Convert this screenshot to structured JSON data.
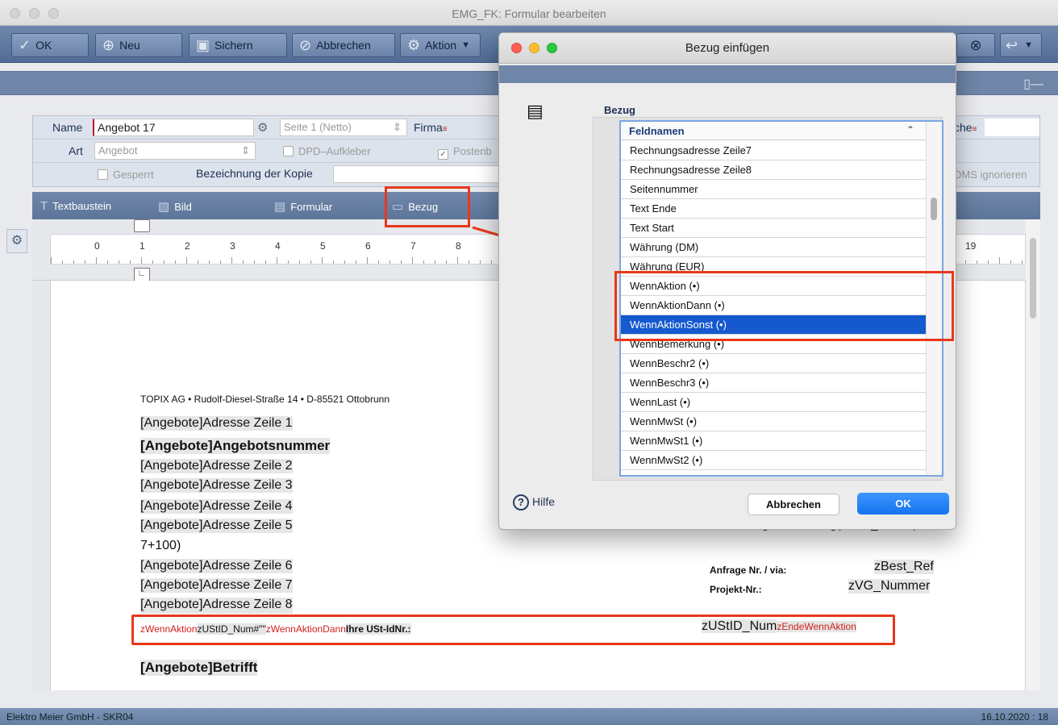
{
  "window": {
    "title": "EMG_FK: Formular bearbeiten"
  },
  "toolbar": {
    "ok": "OK",
    "neu": "Neu",
    "sichern": "Sichern",
    "abbrechen": "Abbrechen",
    "aktion": "Aktion"
  },
  "form": {
    "name_label": "Name",
    "name_value": "Angebot 17",
    "seite_value": "Seite 1 (Netto)",
    "firma_label": "Firma",
    "suche_label": "che",
    "art_label": "Art",
    "art_value": "Angebot",
    "dpd_label": "DPD–Aufkleber",
    "posten_label": "Postenb",
    "gesperrt_label": "Gesperrt",
    "kopie_label": "Bezeichnung der Kopie",
    "dms_label": "DMS ignorieren"
  },
  "editor_toolbar": {
    "textbaustein": "Textbaustein",
    "bild": "Bild",
    "formular": "Formular",
    "bezug": "Bezug"
  },
  "ruler": {
    "numbers": [
      "0",
      "1",
      "2",
      "3",
      "4",
      "5",
      "6",
      "7",
      "8",
      "19"
    ]
  },
  "document": {
    "sender": "TOPIX AG • Rudolf-Diesel-Straße 14 • D-85521 Ottobrunn",
    "line1": "[Angebote]Adresse Zeile 1",
    "line_nr": "[Angebote]Angebotsnummer",
    "line2": "[Angebote]Adresse Zeile 2",
    "line3": "[Angebote]Adresse Zeile 3",
    "line4": "[Angebote]Adresse Zeile 4",
    "line5": "[Angebote]Adresse Zeile 5",
    "line5b": "7+100)",
    "line6": "[Angebote]Adresse Zeile 6",
    "line7": "[Angebote]Adresse Zeile 7",
    "line8": "[Angebote]Adresse Zeile 8",
    "betrifft": "[Angebote]Betrifft",
    "anfrage_partial": "Ihre Anfrage vom:String(zBest_Datum)",
    "anfrage_nr_label": "Anfrage Nr. / via:",
    "anfrage_nr_value": "zBest_Ref",
    "projekt_label": "Projekt-Nr.:",
    "projekt_value": "zVG_Nummer",
    "cond": {
      "wenn": "zWennAktion",
      "field": "zUStID_Num#\"\"",
      "dann": "zWennAktionDann",
      "text": "Ihre USt-IdNr.:",
      "value": "zUStID_Num",
      "ende": "zEndeWennAktion"
    }
  },
  "statusbar": {
    "company": "Elektro Meier GmbH - SKR04",
    "date": "16.10.2020 : 18"
  },
  "dialog": {
    "title": "Bezug einfügen",
    "bezug_label": "Bezug",
    "list_header": "Feldnamen",
    "items": [
      "Rechnungsadresse Zeile7",
      "Rechnungsadresse Zeile8",
      "Seitennummer",
      "Text Ende",
      "Text Start",
      "Währung (DM)",
      "Währung (EUR)",
      "WennAktion (•)",
      "WennAktionDann (•)",
      "WennAktionSonst (•)",
      "WennBemerkung (•)",
      "WennBeschr2 (•)",
      "WennBeschr3 (•)",
      "WennLast (•)",
      "WennMwSt (•)",
      "WennMwSt1 (•)",
      "WennMwSt2 (•)"
    ],
    "selected_index": 9,
    "help": "Hilfe",
    "cancel": "Abbrechen",
    "ok": "OK"
  },
  "colors": {
    "accent": "#1659cf",
    "highlight": "#e8381a",
    "toolbar": "#5f78a0"
  }
}
